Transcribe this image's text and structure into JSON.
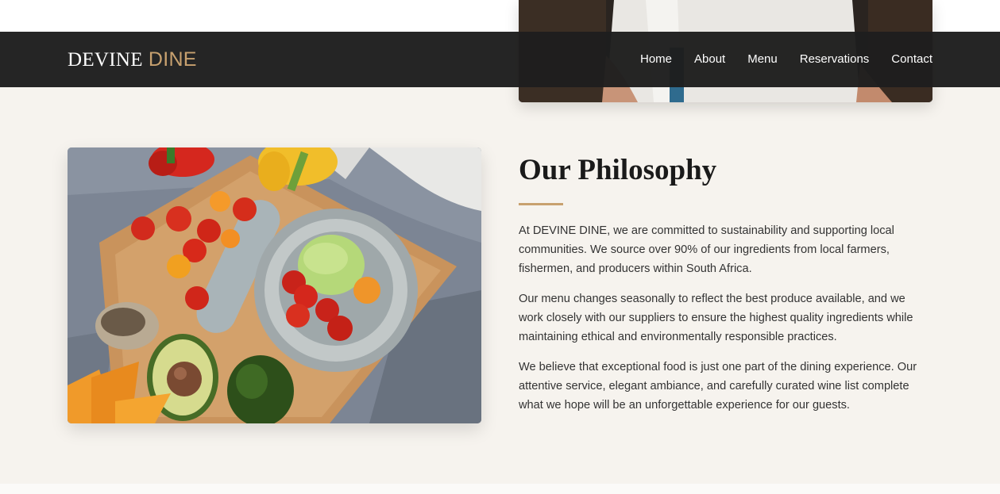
{
  "brand": {
    "name_primary": "DEVINE",
    "name_accent": "DINE"
  },
  "nav": {
    "items": [
      {
        "label": "Home"
      },
      {
        "label": "About"
      },
      {
        "label": "Menu"
      },
      {
        "label": "Reservations"
      },
      {
        "label": "Contact"
      }
    ]
  },
  "philosophy": {
    "title": "Our Philosophy",
    "paragraphs": [
      "At DEVINE DINE, we are committed to sustainability and supporting local communities. We source over 90% of our ingredients from local farmers, fishermen, and producers within South Africa.",
      "Our menu changes seasonally to reflect the best produce available, and we work closely with our suppliers to ensure the highest quality ingredients while maintaining ethical and environmentally responsible practices.",
      "We believe that exceptional food is just one part of the dining experience. Our attentive service, elegant ambiance, and carefully curated wine list complete what we hope will be an unforgettable experience for our guests."
    ]
  },
  "colors": {
    "accent": "#c8a16f",
    "navbar_bg": "#1e1e1e",
    "section_bg": "#f6f3ee",
    "text": "#333333",
    "title": "#1a1a1a"
  }
}
